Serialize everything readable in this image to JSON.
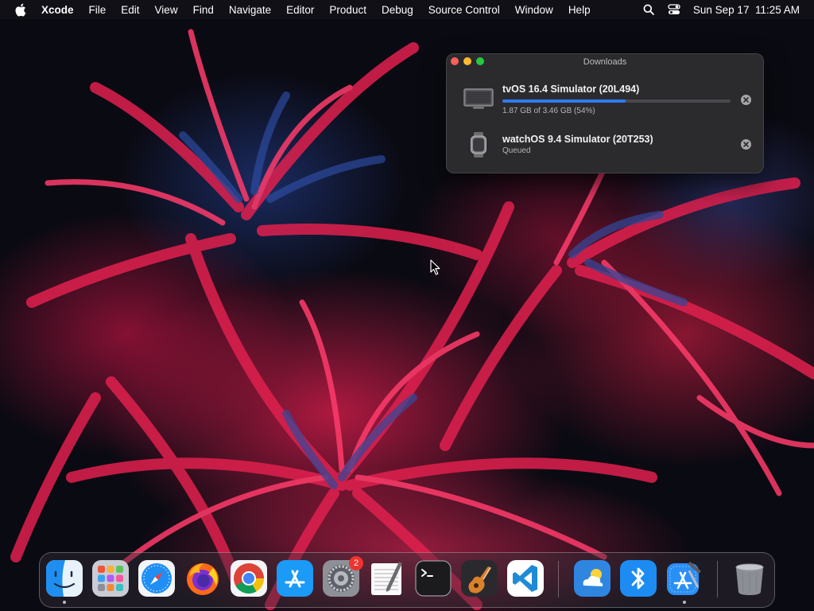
{
  "menubar": {
    "apple_icon": "apple-logo-icon",
    "app_name": "Xcode",
    "items": [
      "File",
      "Edit",
      "View",
      "Find",
      "Navigate",
      "Editor",
      "Product",
      "Debug",
      "Source Control",
      "Window",
      "Help"
    ],
    "datetime": "Sun Sep 17  11:25 AM",
    "status_icons": [
      "search-icon",
      "control-center-icon"
    ]
  },
  "downloads": {
    "title": "Downloads",
    "items": [
      {
        "name": "tvOS 16.4 Simulator (20L494)",
        "status": "1.87 GB of 3.46 GB (54%)",
        "progress": 0.54,
        "icon": "tv-icon",
        "show_progress": true
      },
      {
        "name": "watchOS 9.4 Simulator (20T253)",
        "status": "Queued",
        "icon": "watch-icon",
        "show_progress": false
      }
    ],
    "accent_color": "#2f7cf6"
  },
  "dock": {
    "apps": [
      {
        "name": "Finder",
        "icon": "finder-icon",
        "running": true
      },
      {
        "name": "Launchpad",
        "icon": "launchpad-icon",
        "running": false
      },
      {
        "name": "Safari",
        "icon": "safari-icon",
        "running": false
      },
      {
        "name": "Firefox",
        "icon": "firefox-icon",
        "running": false
      },
      {
        "name": "Google Chrome",
        "icon": "chrome-icon",
        "running": false
      },
      {
        "name": "App Store",
        "icon": "app-store-icon",
        "running": false
      },
      {
        "name": "System Settings",
        "icon": "system-settings-icon",
        "running": false,
        "badge": "2"
      },
      {
        "name": "TextEdit",
        "icon": "textedit-icon",
        "running": false
      },
      {
        "name": "Terminal",
        "icon": "terminal-icon",
        "running": false
      },
      {
        "name": "GarageBand",
        "icon": "garageband-icon",
        "running": false
      },
      {
        "name": "Visual Studio Code",
        "icon": "vscode-icon",
        "running": false
      },
      {
        "name": "Weather",
        "icon": "weather-icon",
        "running": false
      },
      {
        "name": "Bluetooth File Exchange",
        "icon": "bluetooth-icon",
        "running": false
      },
      {
        "name": "Xcode",
        "icon": "xcode-icon",
        "running": true
      },
      {
        "name": "Trash",
        "icon": "trash-icon",
        "running": false
      }
    ]
  }
}
